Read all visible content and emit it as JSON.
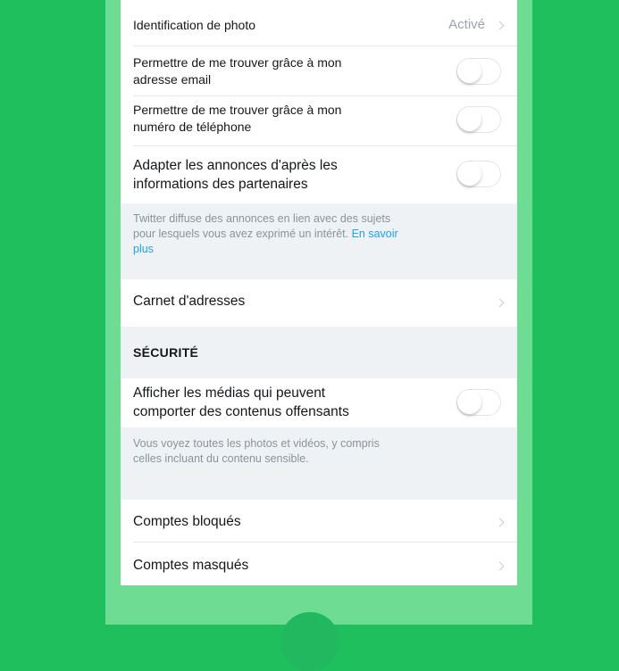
{
  "settings": {
    "photo_tagging": {
      "label": "Identification de photo",
      "value": "Activé"
    },
    "find_by_email": {
      "label_line1": "Permettre de me trouver grâce à mon",
      "label_line2": "adresse email"
    },
    "find_by_phone": {
      "label_line1": "Permettre de me trouver grâce à mon",
      "label_line2": "numéro de téléphone"
    },
    "personalize_ads": {
      "label_line1": "Adapter les annonces d'après les",
      "label_line2": "informations des partenaires"
    },
    "ads_note": {
      "text_line1": "Twitter diffuse des annonces en lien avec des sujets",
      "text_line2_prefix": "pour lesquels vous avez exprimé un intérêt. ",
      "link_part1": "En savoir",
      "link_part2": "plus"
    },
    "address_book": {
      "label": "Carnet d'adresses"
    },
    "security_section": {
      "title": "SÉCURITÉ"
    },
    "sensitive_media": {
      "label_line1": "Afficher les médias qui peuvent",
      "label_line2": "comporter des contenus offensants"
    },
    "sensitive_note": {
      "text_line1": "Vous voyez toutes les photos et vidéos, y compris",
      "text_line2": "celles incluant du contenu sensible."
    },
    "blocked_accounts": {
      "label": "Comptes bloqués"
    },
    "muted_accounts": {
      "label": "Comptes masqués"
    }
  },
  "toggles": {
    "find_by_email": false,
    "find_by_phone": false,
    "personalize_ads": false,
    "sensitive_media": false
  },
  "colors": {
    "background": "#1fbf5e",
    "frame": "#6fdc94",
    "link": "#1da1f2"
  }
}
